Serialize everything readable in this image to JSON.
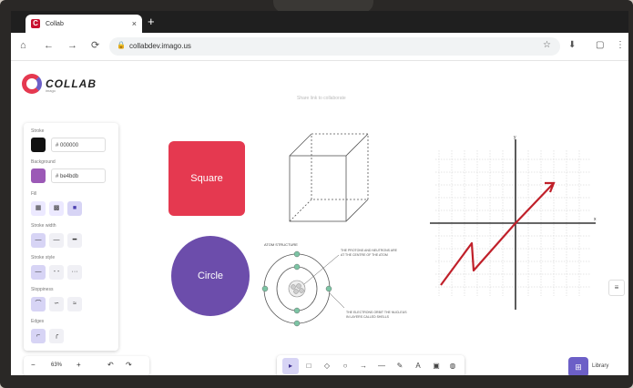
{
  "browser": {
    "tab_title": "Collab",
    "tab_close": "×",
    "new_tab": "+",
    "url": "collabdev.imago.us",
    "nav": {
      "home": "⌂",
      "back": "←",
      "forward": "→",
      "reload": "⟳"
    },
    "icons": {
      "lock": "🔒",
      "star": "☆",
      "download": "⬇",
      "extensions": "▢",
      "menu": "⋮"
    }
  },
  "app": {
    "logo_text": "COLLAB",
    "logo_sub": "imago",
    "share_hint": "Share link to collaborate",
    "panel": {
      "stroke_label": "Stroke",
      "stroke_color": "#000000",
      "stroke_hex": "# 000000",
      "background_label": "Background",
      "background_color": "#be4bdb",
      "background_hex": "# be4bdb",
      "fill_label": "Fill",
      "stroke_width_label": "Stroke width",
      "stroke_style_label": "Stroke style",
      "sloppiness_label": "Sloppiness",
      "edges_label": "Edges"
    },
    "shapes": {
      "square_label": "Square",
      "circle_label": "Circle",
      "atom_title": "ATOM STRUCTURE",
      "atom_note_top": "THE PROTONS AND NEUTRONS ARE AT THE CENTRE OF THE ATOM",
      "atom_note_bottom": "THE ELECTRONS ORBIT THE NUCLEUS IN LAYERS CALLED SHELLS"
    },
    "zoom": {
      "minus": "−",
      "level": "63%",
      "plus": "+",
      "undo": "↶",
      "redo": "↷"
    },
    "toolbar": [
      "▸",
      "□",
      "◇",
      "○",
      "→",
      "—",
      "✎",
      "A",
      "▣",
      "◍"
    ],
    "library_label": "Library",
    "library_icon": "⊞",
    "side_menu_icon": "≡"
  }
}
